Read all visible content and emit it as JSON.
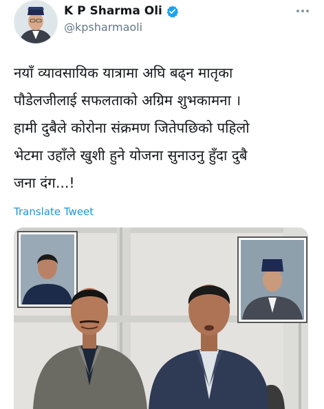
{
  "author": {
    "name": "K P Sharma Oli",
    "handle": "@kpsharmaoli",
    "verified": true
  },
  "tweet": {
    "text_lines": [
      "नयाँ व्यावसायिक यात्रामा अघि बढ्न मातृका",
      "पौडेलजीलाई सफलताको अग्रिम शुभकामना ।",
      "हामी दुबैले कोरोना संक्रमण जितेपछिको पहिलो",
      "भेटमा उहाँले खुशी हुने योजना सुनाउनु हुँदा दुबै",
      "जना दंग...!"
    ],
    "translate_label": "Translate Tweet"
  },
  "icons": {
    "verified": "verified-badge-icon",
    "more": "more-options-icon"
  },
  "colors": {
    "name": "#14171a",
    "handle": "#657786",
    "link": "#1b95e0",
    "verified": "#1da1f2",
    "photo_wall": "#e3e2de",
    "suit_left": "#6b6a63",
    "suit_right": "#2f3a55"
  }
}
